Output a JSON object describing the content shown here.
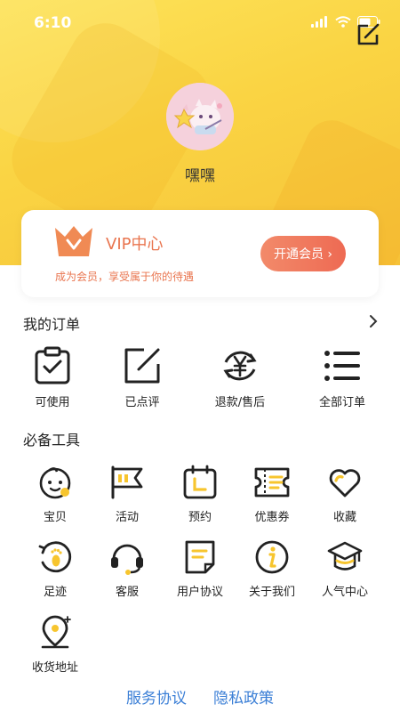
{
  "status_bar": {
    "time": "6:10"
  },
  "profile": {
    "nickname": "嘿嘿"
  },
  "vip": {
    "title": "VIP中心",
    "subtitle": "成为会员，享受属于你的待遇",
    "button_label": "开通会员 ›"
  },
  "orders": {
    "title": "我的订单",
    "items": [
      {
        "label": "可使用",
        "icon": "clipboard-check-icon"
      },
      {
        "label": "已点评",
        "icon": "edit-square-icon"
      },
      {
        "label": "退款/售后",
        "icon": "yen-refund-icon"
      },
      {
        "label": "全部订单",
        "icon": "list-icon"
      }
    ]
  },
  "tools": {
    "title": "必备工具",
    "items": [
      {
        "label": "宝贝",
        "icon": "baby-icon"
      },
      {
        "label": "活动",
        "icon": "flag-icon"
      },
      {
        "label": "预约",
        "icon": "calendar-icon"
      },
      {
        "label": "优惠券",
        "icon": "ticket-icon"
      },
      {
        "label": "收藏",
        "icon": "heart-icon"
      },
      {
        "label": "足迹",
        "icon": "footprint-icon"
      },
      {
        "label": "客服",
        "icon": "headset-icon"
      },
      {
        "label": "用户协议",
        "icon": "document-icon"
      },
      {
        "label": "关于我们",
        "icon": "info-icon"
      },
      {
        "label": "人气中心",
        "icon": "graduation-cap-icon"
      },
      {
        "label": "收货地址",
        "icon": "location-pin-icon"
      }
    ]
  },
  "footer": {
    "service_agreement": "服务协议",
    "privacy_policy": "隐私政策"
  },
  "colors": {
    "header_yellow": "#fad443",
    "accent_orange": "#e9754f",
    "icon_yellow": "#f7c52e",
    "link_blue": "#3b7fd6"
  }
}
